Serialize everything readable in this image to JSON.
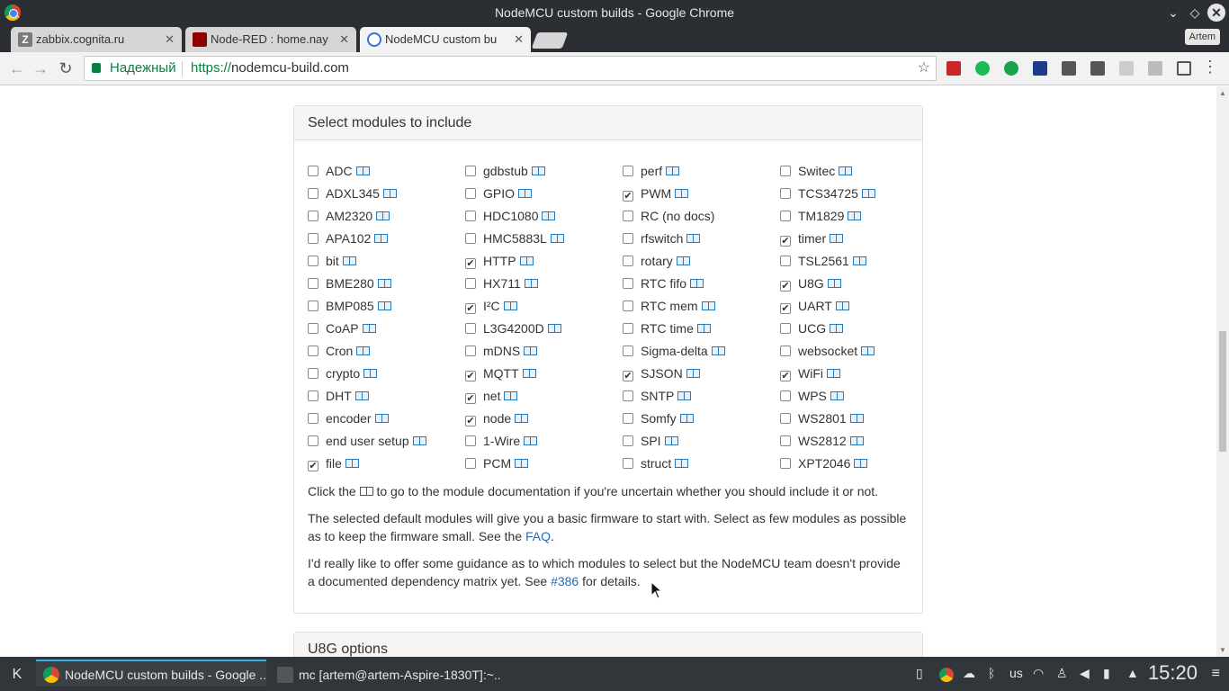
{
  "window": {
    "title": "NodeMCU custom builds - Google Chrome"
  },
  "tabs": [
    {
      "label": "zabbix.cognita.ru"
    },
    {
      "label": "Node-RED : home.nay"
    },
    {
      "label": "NodeMCU custom bu"
    }
  ],
  "profile": {
    "name": "Artem"
  },
  "omnibox": {
    "secure_label": "Надежный",
    "url_scheme": "https://",
    "url_host": "nodemcu-build.com"
  },
  "panel": {
    "heading": "Select modules to include",
    "modules": [
      [
        {
          "name": "ADC",
          "checked": false,
          "doc": true
        },
        {
          "name": "ADXL345",
          "checked": false,
          "doc": true
        },
        {
          "name": "AM2320",
          "checked": false,
          "doc": true
        },
        {
          "name": "APA102",
          "checked": false,
          "doc": true
        },
        {
          "name": "bit",
          "checked": false,
          "doc": true
        },
        {
          "name": "BME280",
          "checked": false,
          "doc": true
        },
        {
          "name": "BMP085",
          "checked": false,
          "doc": true
        },
        {
          "name": "CoAP",
          "checked": false,
          "doc": true
        },
        {
          "name": "Cron",
          "checked": false,
          "doc": true
        },
        {
          "name": "crypto",
          "checked": false,
          "doc": true
        },
        {
          "name": "DHT",
          "checked": false,
          "doc": true
        },
        {
          "name": "encoder",
          "checked": false,
          "doc": true
        },
        {
          "name": "end user setup",
          "checked": false,
          "doc": true
        },
        {
          "name": "file",
          "checked": true,
          "doc": true
        }
      ],
      [
        {
          "name": "gdbstub",
          "checked": false,
          "doc": true
        },
        {
          "name": "GPIO",
          "checked": false,
          "doc": true
        },
        {
          "name": "HDC1080",
          "checked": false,
          "doc": true
        },
        {
          "name": "HMC5883L",
          "checked": false,
          "doc": true
        },
        {
          "name": "HTTP",
          "checked": true,
          "doc": true
        },
        {
          "name": "HX711",
          "checked": false,
          "doc": true
        },
        {
          "name": "I²C",
          "checked": true,
          "doc": true
        },
        {
          "name": "L3G4200D",
          "checked": false,
          "doc": true
        },
        {
          "name": "mDNS",
          "checked": false,
          "doc": true
        },
        {
          "name": "MQTT",
          "checked": true,
          "doc": true
        },
        {
          "name": "net",
          "checked": true,
          "doc": true
        },
        {
          "name": "node",
          "checked": true,
          "doc": true
        },
        {
          "name": "1-Wire",
          "checked": false,
          "doc": true
        },
        {
          "name": "PCM",
          "checked": false,
          "doc": true
        }
      ],
      [
        {
          "name": "perf",
          "checked": false,
          "doc": true
        },
        {
          "name": "PWM",
          "checked": true,
          "doc": true
        },
        {
          "name": "RC (no docs)",
          "checked": false,
          "doc": false
        },
        {
          "name": "rfswitch",
          "checked": false,
          "doc": true
        },
        {
          "name": "rotary",
          "checked": false,
          "doc": true
        },
        {
          "name": "RTC fifo",
          "checked": false,
          "doc": true
        },
        {
          "name": "RTC mem",
          "checked": false,
          "doc": true
        },
        {
          "name": "RTC time",
          "checked": false,
          "doc": true
        },
        {
          "name": "Sigma-delta",
          "checked": false,
          "doc": true
        },
        {
          "name": "SJSON",
          "checked": true,
          "doc": true
        },
        {
          "name": "SNTP",
          "checked": false,
          "doc": true
        },
        {
          "name": "Somfy",
          "checked": false,
          "doc": true
        },
        {
          "name": "SPI",
          "checked": false,
          "doc": true
        },
        {
          "name": "struct",
          "checked": false,
          "doc": true
        }
      ],
      [
        {
          "name": "Switec",
          "checked": false,
          "doc": true
        },
        {
          "name": "TCS34725",
          "checked": false,
          "doc": true
        },
        {
          "name": "TM1829",
          "checked": false,
          "doc": true
        },
        {
          "name": "timer",
          "checked": true,
          "doc": true
        },
        {
          "name": "TSL2561",
          "checked": false,
          "doc": true
        },
        {
          "name": "U8G",
          "checked": true,
          "doc": true
        },
        {
          "name": "UART",
          "checked": true,
          "doc": true
        },
        {
          "name": "UCG",
          "checked": false,
          "doc": true
        },
        {
          "name": "websocket",
          "checked": false,
          "doc": true
        },
        {
          "name": "WiFi",
          "checked": true,
          "doc": true
        },
        {
          "name": "WPS",
          "checked": false,
          "doc": true
        },
        {
          "name": "WS2801",
          "checked": false,
          "doc": true
        },
        {
          "name": "WS2812",
          "checked": false,
          "doc": true
        },
        {
          "name": "XPT2046",
          "checked": false,
          "doc": true
        }
      ]
    ],
    "click_before": "Click the",
    "click_after": "to go to the module documentation if you're uncertain whether you should include it or not.",
    "default_text": "The selected default modules will give you a basic firmware to start with. Select as few modules as possible as to keep the firmware small. See the",
    "faq_link": "FAQ",
    "guidance_text": "I'd really like to offer some guidance as to which modules to select but the NodeMCU team doesn't provide a documented dependency matrix yet. See",
    "issue_link": "#386",
    "guidance_tail": "for details."
  },
  "panel2": {
    "heading": "U8G options"
  },
  "taskbar": {
    "tasks": [
      {
        "label": "NodeMCU custom builds - Google ..."
      },
      {
        "label": "mc [artem@artem-Aspire-1830T]:~..."
      }
    ],
    "keyboard_layout": "us",
    "clock": "15:20"
  },
  "colors": {
    "link": "#2a6ab2",
    "secure_green": "#0b8043",
    "taskbar_bg": "#31363b",
    "active_task_accent": "#3daee9"
  }
}
